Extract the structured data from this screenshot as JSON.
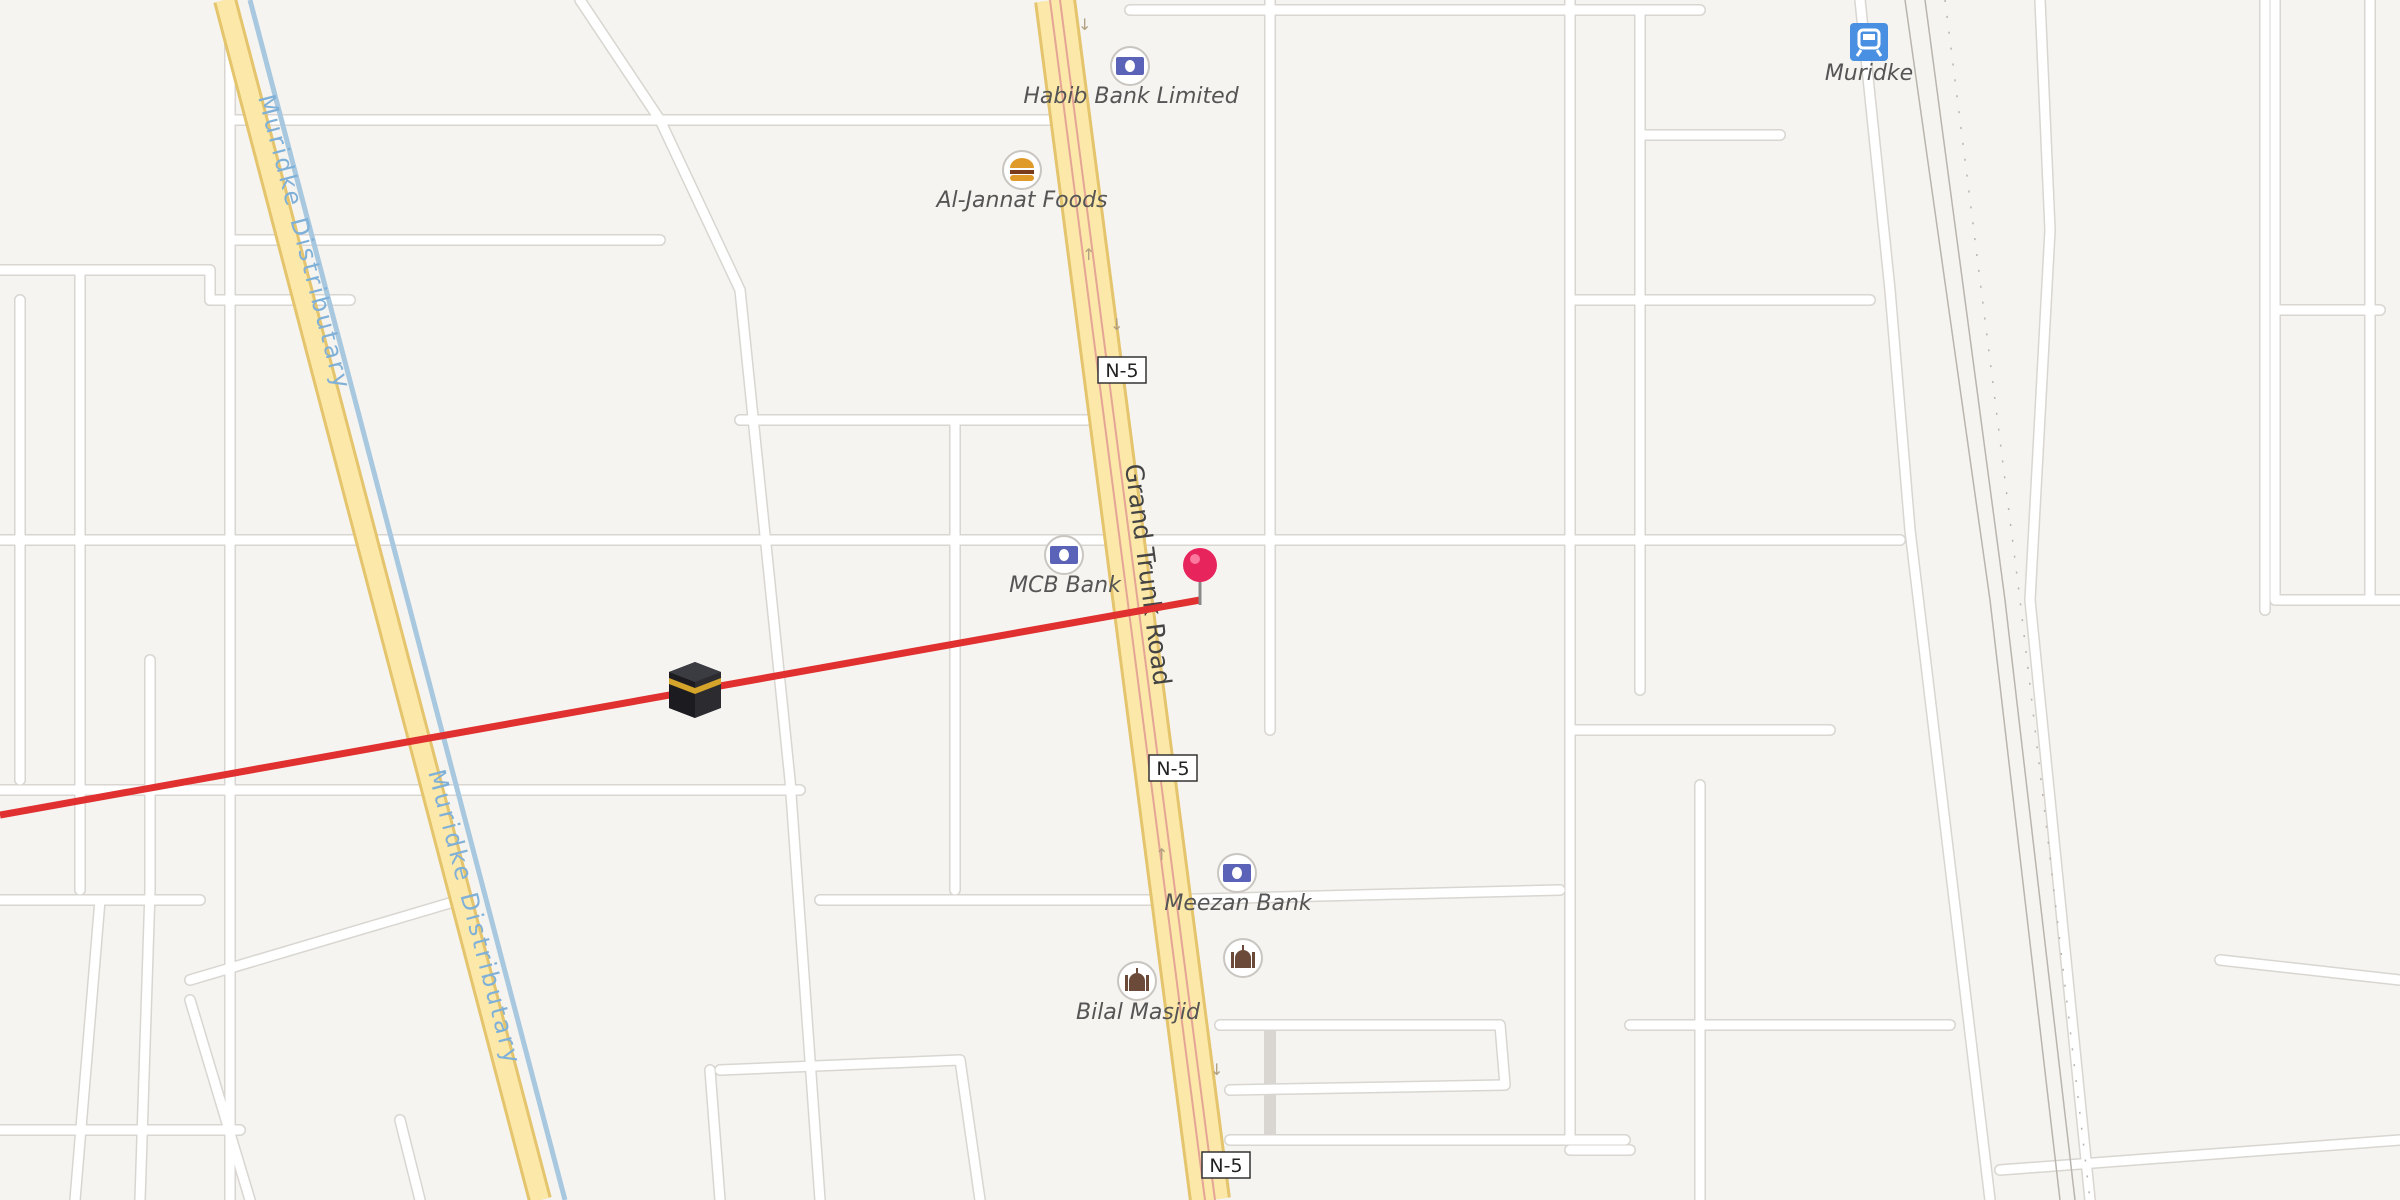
{
  "map": {
    "place_labels": [
      {
        "id": "habib-bank",
        "text": "Habib Bank Limited",
        "icon": "bank-icon"
      },
      {
        "id": "al-jannat",
        "text": "Al-Jannat Foods",
        "icon": "fast-food-icon"
      },
      {
        "id": "mcb-bank",
        "text": "MCB Bank",
        "icon": "bank-icon"
      },
      {
        "id": "meezan-bank",
        "text": "Meezan Bank",
        "icon": "bank-icon"
      },
      {
        "id": "bilal-masjid",
        "text": "Bilal Masjid",
        "icon": "mosque-icon"
      },
      {
        "id": "muridke-station",
        "text": "Muridke",
        "icon": "train-station-icon"
      }
    ],
    "road_labels": {
      "grand_trunk": "Grand Trunk Road",
      "distributary_1": "Muridke Distributary",
      "distributary_2": "Muridke Distributary"
    },
    "shields": [
      "N-5",
      "N-5",
      "N-5"
    ],
    "route_color": "#e03030",
    "pin_color": "#e8245c",
    "kaaba_icon": "kaaba-icon"
  }
}
